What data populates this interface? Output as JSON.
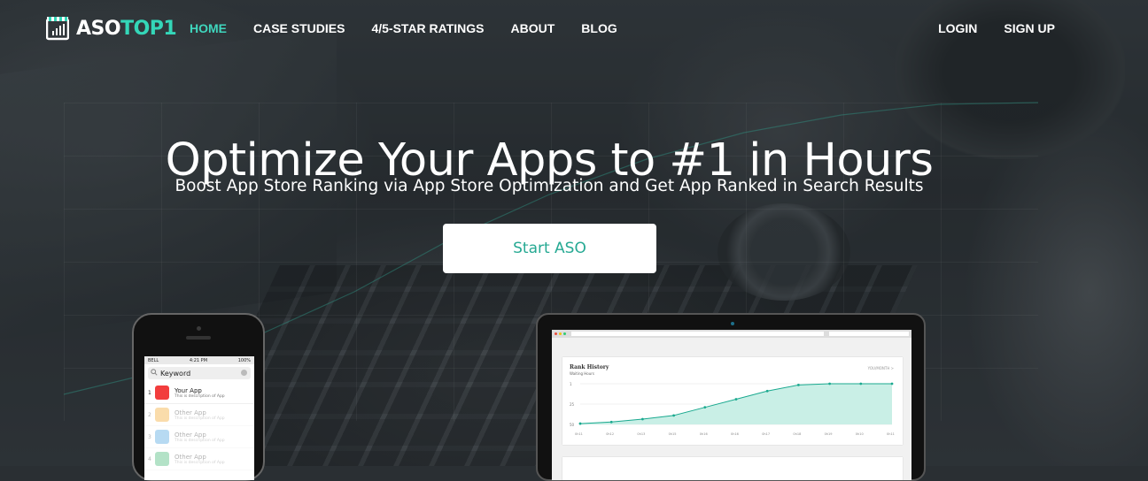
{
  "brand": {
    "part1": "ASO",
    "part2": "TOP1",
    "accent": "#3fd6bd"
  },
  "nav": {
    "items": [
      {
        "label": "HOME",
        "active": true
      },
      {
        "label": "CASE STUDIES",
        "active": false
      },
      {
        "label": "4/5-STAR RATINGS",
        "active": false
      },
      {
        "label": "ABOUT",
        "active": false
      },
      {
        "label": "BLOG",
        "active": false
      }
    ],
    "login": "LOGIN",
    "signup": "SIGN UP"
  },
  "hero": {
    "title": "Optimize Your Apps to #1 in Hours",
    "subtitle": "Boost App Store Ranking via App Store Optimization and Get App Ranked in Search Results",
    "cta": "Start ASO",
    "cta_color": "#26a993"
  },
  "phone": {
    "carrier": "BELL",
    "time": "4:21 PM",
    "battery": "100%",
    "search_value": "Keyword",
    "results": [
      {
        "rank": "1",
        "title": "Your App",
        "desc": "This is description of App",
        "color": "#f23d3d"
      },
      {
        "rank": "2",
        "title": "Other App",
        "desc": "This is description of App",
        "color": "#f39c12"
      },
      {
        "rank": "3",
        "title": "Other App",
        "desc": "This is description of App",
        "color": "#3498db"
      },
      {
        "rank": "4",
        "title": "Other App",
        "desc": "This is description of App",
        "color": "#27ae60"
      }
    ]
  },
  "laptop_card": {
    "title": "Rank History",
    "subtitle": "Waiting Hours",
    "link": "YOU/MONTH >",
    "y_ticks": [
      "1",
      "25",
      "50"
    ],
    "x_ticks": [
      "0h11",
      "0h12",
      "0h13",
      "0h15",
      "0h16",
      "0h16",
      "0h17",
      "0h18",
      "0h19",
      "0h10",
      "0h11"
    ],
    "line_color": "#1aa98f",
    "fill_color": "#c9efe6"
  }
}
